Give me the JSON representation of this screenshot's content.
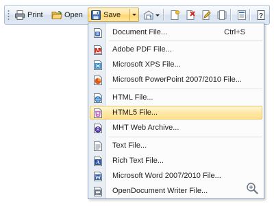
{
  "toolbar": {
    "print_label": "Print",
    "open_label": "Open",
    "save_label": "Save"
  },
  "save_menu": {
    "items": [
      {
        "label": "Document File...",
        "shortcut": "Ctrl+S",
        "icon": "document-file-icon"
      },
      {
        "label": "Adobe PDF File...",
        "icon": "pdf-file-icon"
      },
      {
        "label": "Microsoft XPS File...",
        "icon": "xps-file-icon"
      },
      {
        "label": "Microsoft PowerPoint 2007/2010 File...",
        "icon": "powerpoint-file-icon"
      },
      {
        "label": "HTML File...",
        "icon": "html-file-icon"
      },
      {
        "label": "HTML5 File...",
        "icon": "html5-file-icon",
        "highlighted": true
      },
      {
        "label": "MHT Web Archive...",
        "icon": "mht-file-icon"
      },
      {
        "label": "Text File...",
        "icon": "text-file-icon"
      },
      {
        "label": "Rich Text File...",
        "icon": "rtf-file-icon"
      },
      {
        "label": "Microsoft Word 2007/2010 File...",
        "icon": "word-file-icon"
      },
      {
        "label": "OpenDocument Writer File...",
        "icon": "odt-file-icon"
      }
    ]
  },
  "colors": {
    "highlight_border": "#e5c365",
    "highlight_fill": "#ffe9a6",
    "menu_border": "#8ba0bc",
    "toolbar_border": "#a9bfd6"
  }
}
